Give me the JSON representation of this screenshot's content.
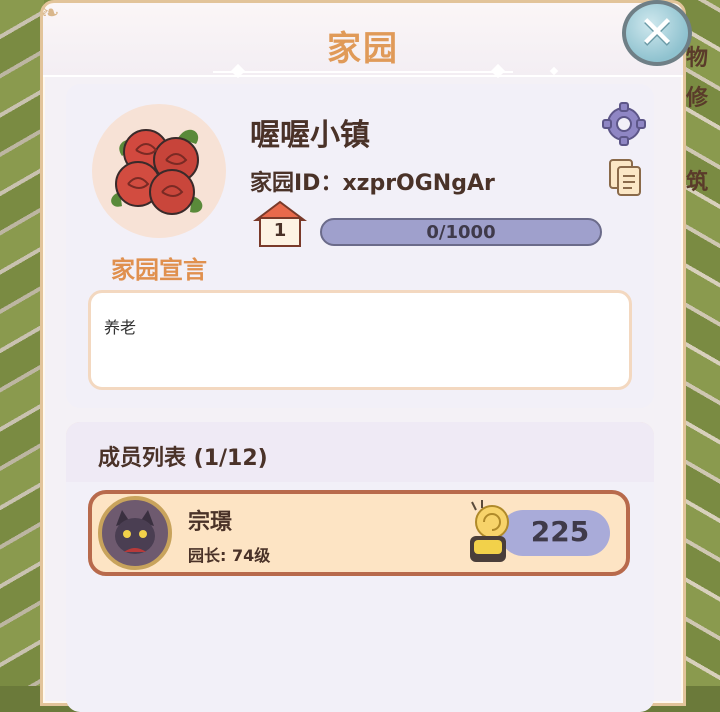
{
  "title": "家园",
  "close_label": "✕",
  "home": {
    "name": "喔喔小镇",
    "id_text": "家园ID：xzprOGNgAr",
    "level": "1",
    "progress_text": "0/1000",
    "progress_fraction": 0,
    "manifesto_label": "家园宣言",
    "manifesto": "养老"
  },
  "members": {
    "title": "成员列表 (1/12)",
    "list": [
      {
        "name": "宗璟",
        "role": "园长: 74级",
        "score": "225"
      }
    ]
  },
  "side_labels": [
    "物",
    "修",
    "筑"
  ],
  "colors": {
    "accent": "#e09a58",
    "progress_bg": "#9fa0cc",
    "row_bg": "#fde4c4",
    "row_border": "#b86a4c"
  },
  "icons": [
    "gear-icon",
    "copy-icon",
    "house-level-icon",
    "snail-icon",
    "rose-avatar-icon",
    "close-icon"
  ]
}
